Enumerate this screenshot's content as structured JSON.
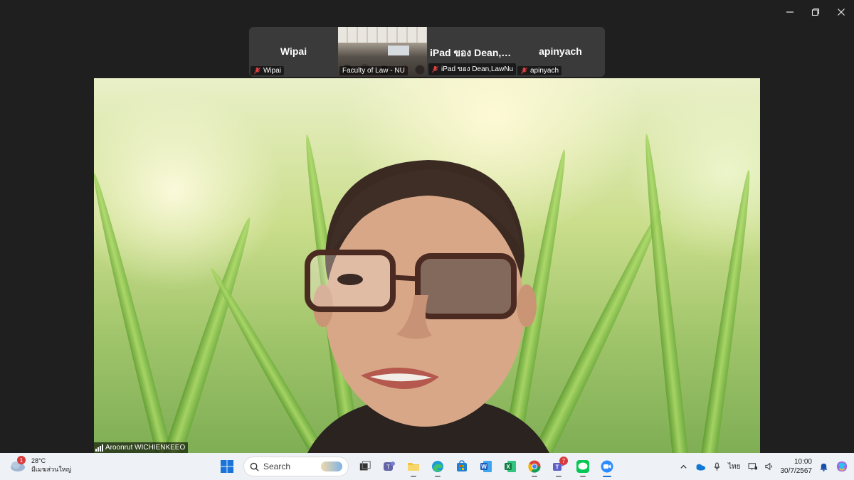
{
  "window": {
    "controls": [
      "minimize",
      "restore",
      "close"
    ]
  },
  "participants": [
    {
      "name": "Wipai",
      "label": "Wipai",
      "muted": true,
      "video": false
    },
    {
      "name": "",
      "label": "Faculty of Law - NU",
      "muted": false,
      "video": true
    },
    {
      "name": "iPad ของ Dean,L...",
      "label": "iPad ของ Dean,LawNu",
      "muted": true,
      "video": false
    },
    {
      "name": "apinyach",
      "label": "apinyach",
      "muted": true,
      "video": false
    }
  ],
  "active_speaker": {
    "name": "Aroonrut WICHIENKEEO"
  },
  "taskbar": {
    "weather": {
      "temp": "28°C",
      "desc": "มีเมฆส่วนใหญ่",
      "badge": "1"
    },
    "search": {
      "placeholder": "Search"
    },
    "teams_badge": "7",
    "tray": {
      "lang": "ไทย"
    },
    "clock": {
      "time": "10:00",
      "date": "30/7/2567"
    }
  },
  "colors": {
    "background": "#1f1f1f",
    "strip": "#3a3a3a",
    "taskbar": "#eef1f5",
    "mute_red": "#e04040"
  }
}
